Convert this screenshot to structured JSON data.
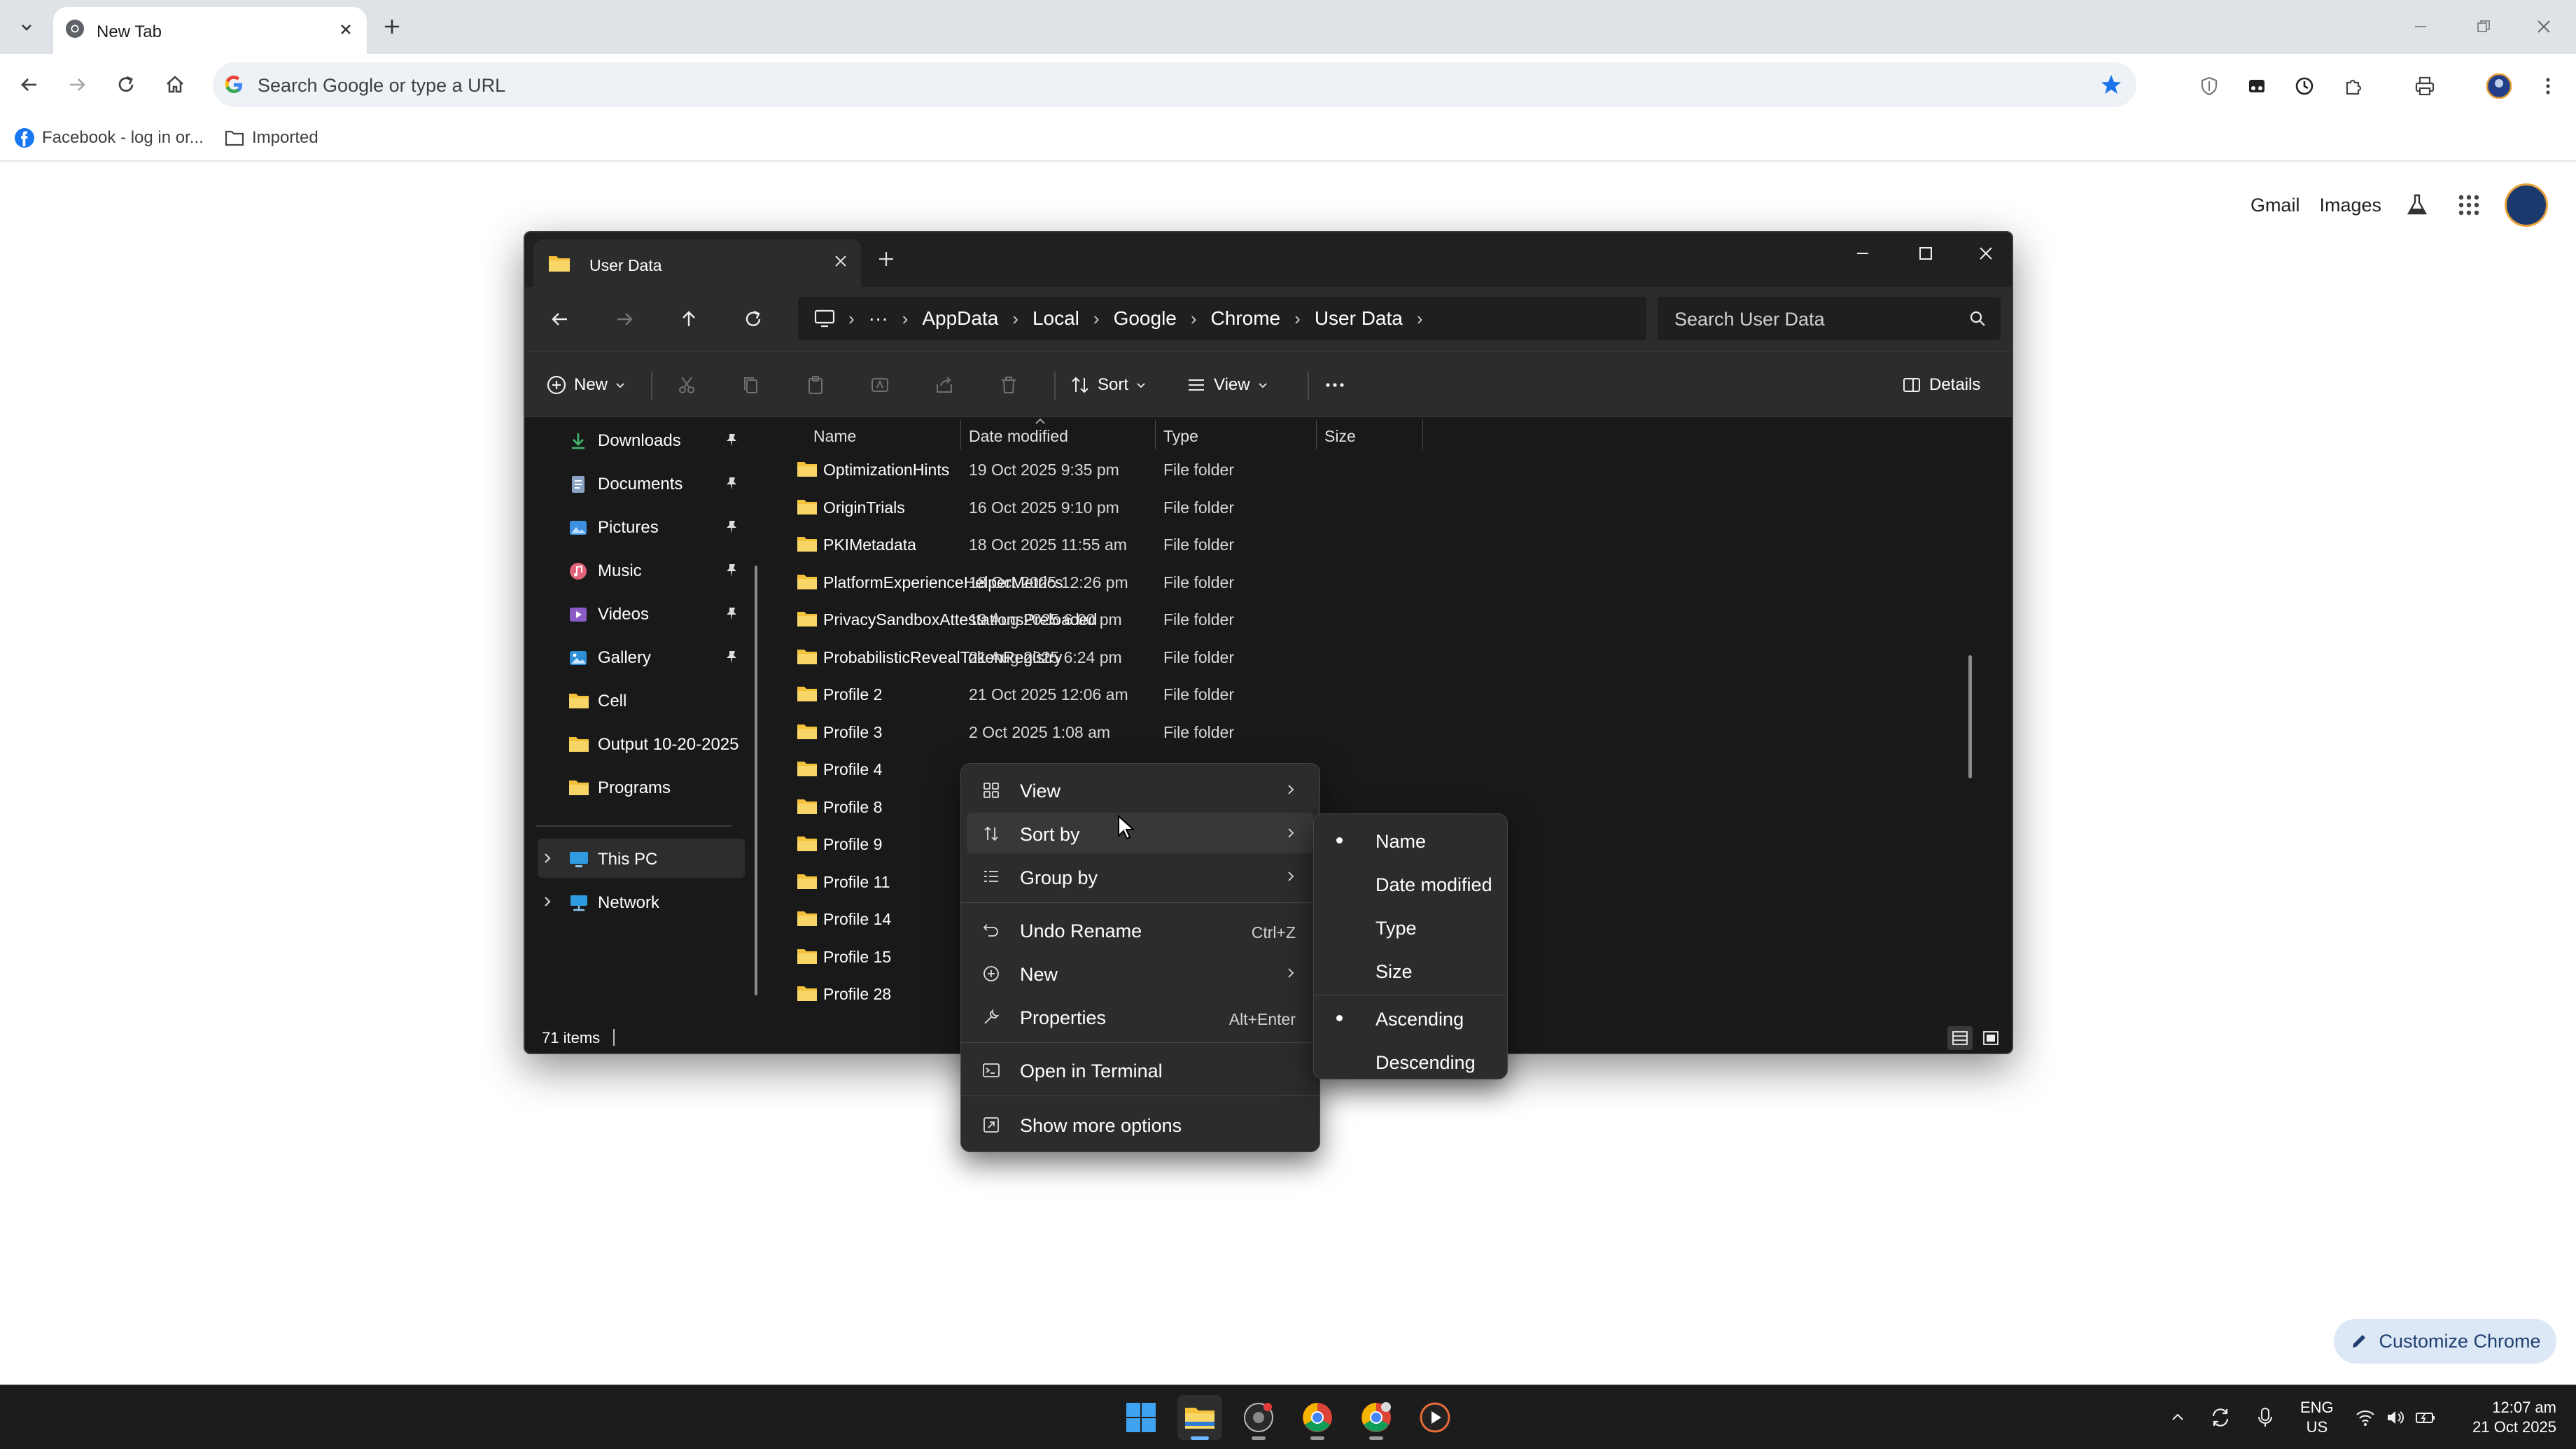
{
  "browser": {
    "tab_title": "New Tab",
    "omnibox_placeholder": "Search Google or type a URL",
    "bookmarks": [
      {
        "label": "Facebook - log in or..."
      },
      {
        "label": "Imported"
      }
    ],
    "ntp_links": {
      "gmail": "Gmail",
      "images": "Images"
    },
    "customize_label": "Customize Chrome"
  },
  "explorer": {
    "tab_title": "User Data",
    "breadcrumb": [
      "AppData",
      "Local",
      "Google",
      "Chrome",
      "User Data"
    ],
    "search_placeholder": "Search User Data",
    "commands": {
      "new": "New",
      "sort": "Sort",
      "view": "View",
      "details": "Details"
    },
    "sidebar": {
      "quick_access": [
        {
          "label": "Downloads",
          "icon": "download-icon",
          "pinned": true
        },
        {
          "label": "Documents",
          "icon": "documents-icon",
          "pinned": true
        },
        {
          "label": "Pictures",
          "icon": "pictures-icon",
          "pinned": true
        },
        {
          "label": "Music",
          "icon": "music-icon",
          "pinned": true
        },
        {
          "label": "Videos",
          "icon": "videos-icon",
          "pinned": true
        },
        {
          "label": "Gallery",
          "icon": "gallery-icon",
          "pinned": true
        },
        {
          "label": "Cell",
          "icon": "folder-icon",
          "pinned": false
        },
        {
          "label": "Output 10-20-2025",
          "icon": "folder-icon",
          "pinned": false
        },
        {
          "label": "Programs",
          "icon": "folder-icon",
          "pinned": false
        }
      ],
      "this_pc": "This PC",
      "network": "Network"
    },
    "columns": {
      "name": "Name",
      "date": "Date modified",
      "type": "Type",
      "size": "Size"
    },
    "rows": [
      {
        "name": "OptimizationHints",
        "date": "19 Oct 2025 9:35 pm",
        "type": "File folder"
      },
      {
        "name": "OriginTrials",
        "date": "16 Oct 2025 9:10 pm",
        "type": "File folder"
      },
      {
        "name": "PKIMetadata",
        "date": "18 Oct 2025 11:55 am",
        "type": "File folder"
      },
      {
        "name": "PlatformExperienceHelperMetrics",
        "date": "18 Oct 2025 12:26 pm",
        "type": "File folder"
      },
      {
        "name": "PrivacySandboxAttestationsPreloaded",
        "date": "19 Aug 2025 6:00 pm",
        "type": "File folder"
      },
      {
        "name": "ProbabilisticRevealTokenRegistry",
        "date": "21 Aug 2025 6:24 pm",
        "type": "File folder"
      },
      {
        "name": "Profile 2",
        "date": "21 Oct 2025 12:06 am",
        "type": "File folder"
      },
      {
        "name": "Profile 3",
        "date": "2 Oct 2025 1:08 am",
        "type": "File folder"
      },
      {
        "name": "Profile 4",
        "date": "",
        "type": "File folder"
      },
      {
        "name": "Profile 8",
        "date": "",
        "type": "File folder"
      },
      {
        "name": "Profile 9",
        "date": "",
        "type": ""
      },
      {
        "name": "Profile 11",
        "date": "",
        "type": ""
      },
      {
        "name": "Profile 14",
        "date": "",
        "type": ""
      },
      {
        "name": "Profile 15",
        "date": "",
        "type": ""
      },
      {
        "name": "Profile 28",
        "date": "",
        "type": ""
      }
    ],
    "status": {
      "item_count": "71 items"
    }
  },
  "context_menu": {
    "items": [
      {
        "label": "View",
        "shortcut": "",
        "submenu": true,
        "icon": "grid-icon"
      },
      {
        "label": "Sort by",
        "shortcut": "",
        "submenu": true,
        "icon": "sort-icon"
      },
      {
        "label": "Group by",
        "shortcut": "",
        "submenu": true,
        "icon": "group-icon"
      },
      {
        "label": "Undo Rename",
        "shortcut": "Ctrl+Z",
        "submenu": false,
        "icon": "undo-icon"
      },
      {
        "label": "New",
        "shortcut": "",
        "submenu": true,
        "icon": "plus-circle-icon"
      },
      {
        "label": "Properties",
        "shortcut": "Alt+Enter",
        "submenu": false,
        "icon": "wrench-icon"
      },
      {
        "label": "Open in Terminal",
        "shortcut": "",
        "submenu": false,
        "icon": "terminal-icon"
      },
      {
        "label": "Show more options",
        "shortcut": "",
        "submenu": false,
        "icon": "expand-icon"
      }
    ],
    "hovered": "Sort by"
  },
  "sort_submenu": {
    "fields": [
      {
        "label": "Name",
        "selected": true
      },
      {
        "label": "Date modified",
        "selected": false
      },
      {
        "label": "Type",
        "selected": false
      },
      {
        "label": "Size",
        "selected": false
      }
    ],
    "order": [
      {
        "label": "Ascending",
        "selected": true
      },
      {
        "label": "Descending",
        "selected": false
      }
    ]
  },
  "taskbar": {
    "lang_line1": "ENG",
    "lang_line2": "US",
    "time": "12:07 am",
    "date": "21 Oct 2025"
  },
  "colors": {
    "explorer_bg": "#191919",
    "menu_bg": "#2c2c2c",
    "folder_yellow": "#f3c13a",
    "chrome_accent": "#1a73e8"
  }
}
